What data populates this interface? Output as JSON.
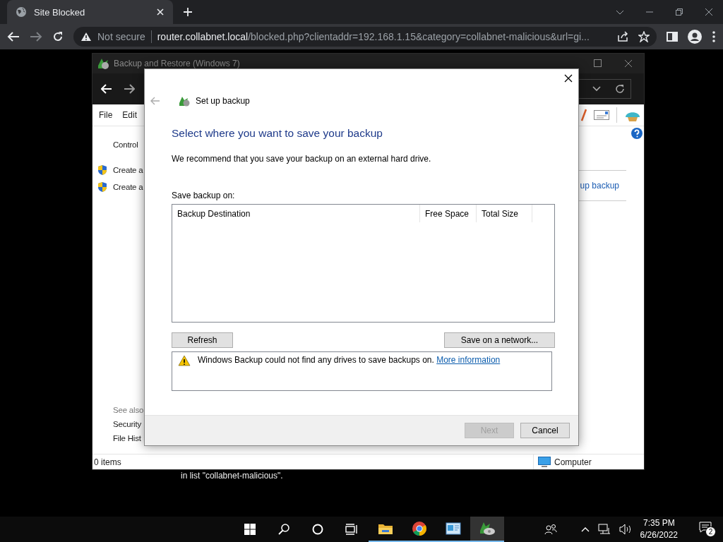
{
  "browser": {
    "tab_title": "Site Blocked",
    "security_label": "Not secure",
    "url_host": "router.collabnet.local",
    "url_path": "/blocked.php?clientaddr=192.168.1.15&category=collabnet-malicious&url=gi..."
  },
  "page": {
    "message_fragment": "in list \"collabnet-malicious\"."
  },
  "explorer": {
    "title": "Backup and Restore (Windows 7)",
    "menu": [
      "File",
      "Edit"
    ],
    "sidebar": [
      {
        "kind": "plain",
        "label": "Control"
      },
      {
        "kind": "shield",
        "label": "Create a"
      },
      {
        "kind": "shield",
        "label": "Create a"
      }
    ],
    "see_also": {
      "heading": "See also",
      "links": [
        "Security",
        "File Hist"
      ]
    },
    "main_link": "up backup",
    "status": "0 items",
    "zone": "Computer"
  },
  "dialog": {
    "title": "Set up backup",
    "heading": "Select where you want to save your backup",
    "intro": "We recommend that you save your backup on an external hard drive.",
    "list_label": "Save backup on:",
    "columns": [
      "Backup Destination",
      "Free Space",
      "Total Size"
    ],
    "refresh_button": "Refresh",
    "network_button": "Save on a network...",
    "message": "Windows Backup could not find any drives to save backups on.",
    "message_link": "More information",
    "footer_buttons": [
      {
        "label": "Next",
        "disabled": true
      },
      {
        "label": "Cancel",
        "disabled": false
      }
    ]
  },
  "taskbar": {
    "apps": [
      {
        "kind": "folder",
        "selected": false
      },
      {
        "kind": "chrome",
        "selected": false
      },
      {
        "kind": "control-panel",
        "selected": false
      },
      {
        "kind": "backup",
        "selected": true
      }
    ],
    "time": "7:35 PM",
    "date": "6/26/2022",
    "notification_count": "2"
  }
}
